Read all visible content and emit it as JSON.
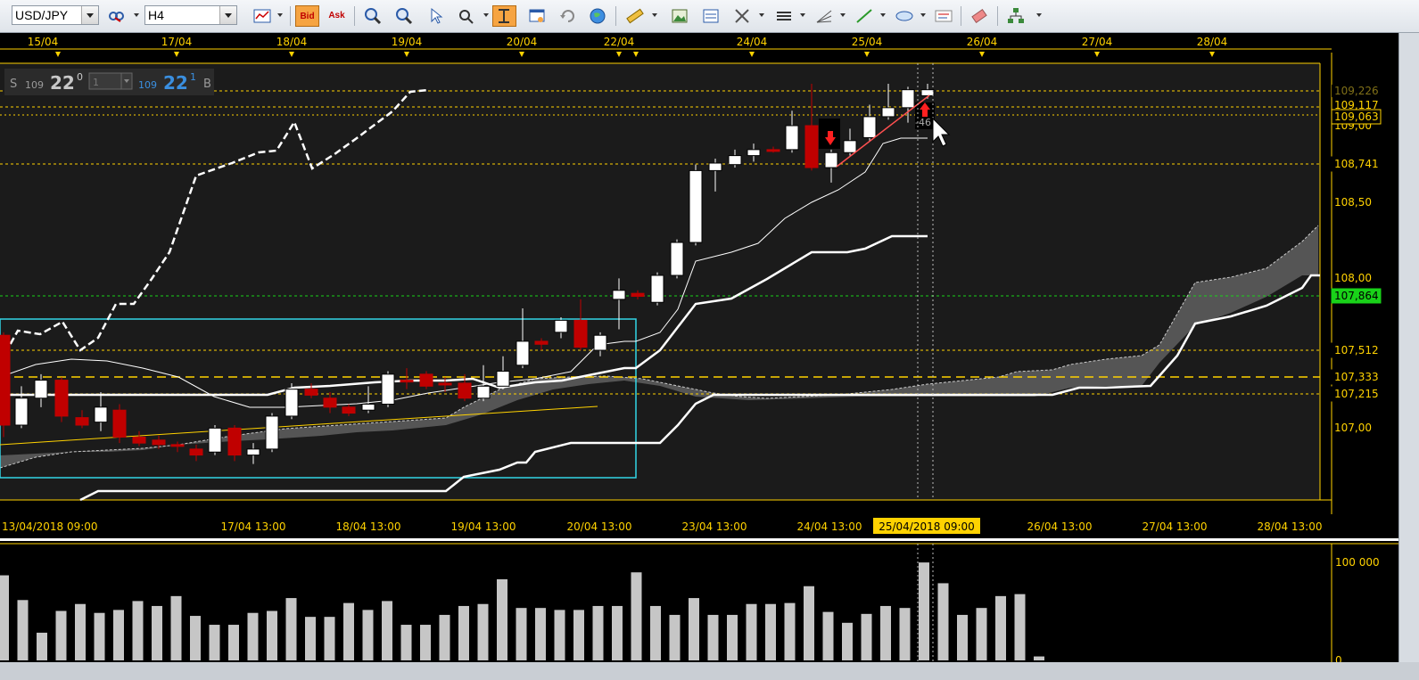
{
  "toolbar": {
    "symbol": "USD/JPY",
    "timeframe": "H4",
    "bid_label": "Bid",
    "ask_label": "Ask"
  },
  "chart": {
    "date_axis_top": [
      "15/04",
      "17/04",
      "18/04",
      "19/04",
      "20/04",
      "22/04",
      "24/04",
      "25/04",
      "26/04",
      "27/04",
      "28/04"
    ],
    "time_axis_bottom": [
      "13/04/2018 09:00",
      "17/04 13:00",
      "18/04 13:00",
      "19/04 13:00",
      "20/04 13:00",
      "23/04 13:00",
      "24/04 13:00",
      "26/04 13:00",
      "27/04 13:00",
      "28/04 13:00"
    ],
    "crosshair_time": "25/04/2018 09:00",
    "price_axis_labels": [
      "109,00",
      "108,50",
      "108,00",
      "107,00"
    ],
    "price_tags": [
      {
        "text": "109,063",
        "bg": "#000000",
        "fg": "#ffd200",
        "border": "#ffd200"
      },
      {
        "text": "108,741",
        "bg": "#000000",
        "fg": "#ffd200",
        "border": "#000000"
      },
      {
        "text": "107,864",
        "bg": "#19d219",
        "fg": "#000000",
        "border": "#19d219"
      },
      {
        "text": "107,512",
        "bg": "#000000",
        "fg": "#ffd200",
        "border": "#000000"
      },
      {
        "text": "107,333",
        "bg": "#000000",
        "fg": "#ffd200",
        "border": "#000000"
      },
      {
        "text": "107,215",
        "bg": "#000000",
        "fg": "#ffd200",
        "border": "#000000"
      }
    ],
    "partial_tags": [
      "109,226",
      "109,117"
    ],
    "one_click": {
      "sell_label": "S",
      "sell_big": "109",
      "sell_price": "22",
      "sell_sup": "0",
      "quantity": "1",
      "buy_big": "109",
      "buy_price": "22",
      "buy_sup": "1",
      "buy_label": "B"
    },
    "measure_label": "-46",
    "colors": {
      "bull": "#ffffff",
      "bear": "#c00000",
      "level": "#ffd200",
      "green_level": "#19d219",
      "box": "#33d6e6",
      "cloud": "#555555"
    }
  },
  "volume": {
    "axis_labels": [
      "100 000",
      "0"
    ],
    "max": 100000,
    "values": [
      86000,
      61000,
      28000,
      50000,
      57000,
      48000,
      51000,
      60000,
      55000,
      65000,
      45000,
      36000,
      36000,
      48000,
      50000,
      63000,
      44000,
      44000,
      58000,
      51000,
      60000,
      36000,
      36000,
      46000,
      55000,
      57000,
      82000,
      53000,
      53000,
      51000,
      51000,
      55000,
      55000,
      89000,
      55000,
      46000,
      63000,
      46000,
      46000,
      57000,
      57000,
      58000,
      75000,
      49000,
      38000,
      47000,
      55000,
      53000,
      99000,
      78000,
      46000,
      53000,
      65000,
      67000,
      4000
    ]
  }
}
